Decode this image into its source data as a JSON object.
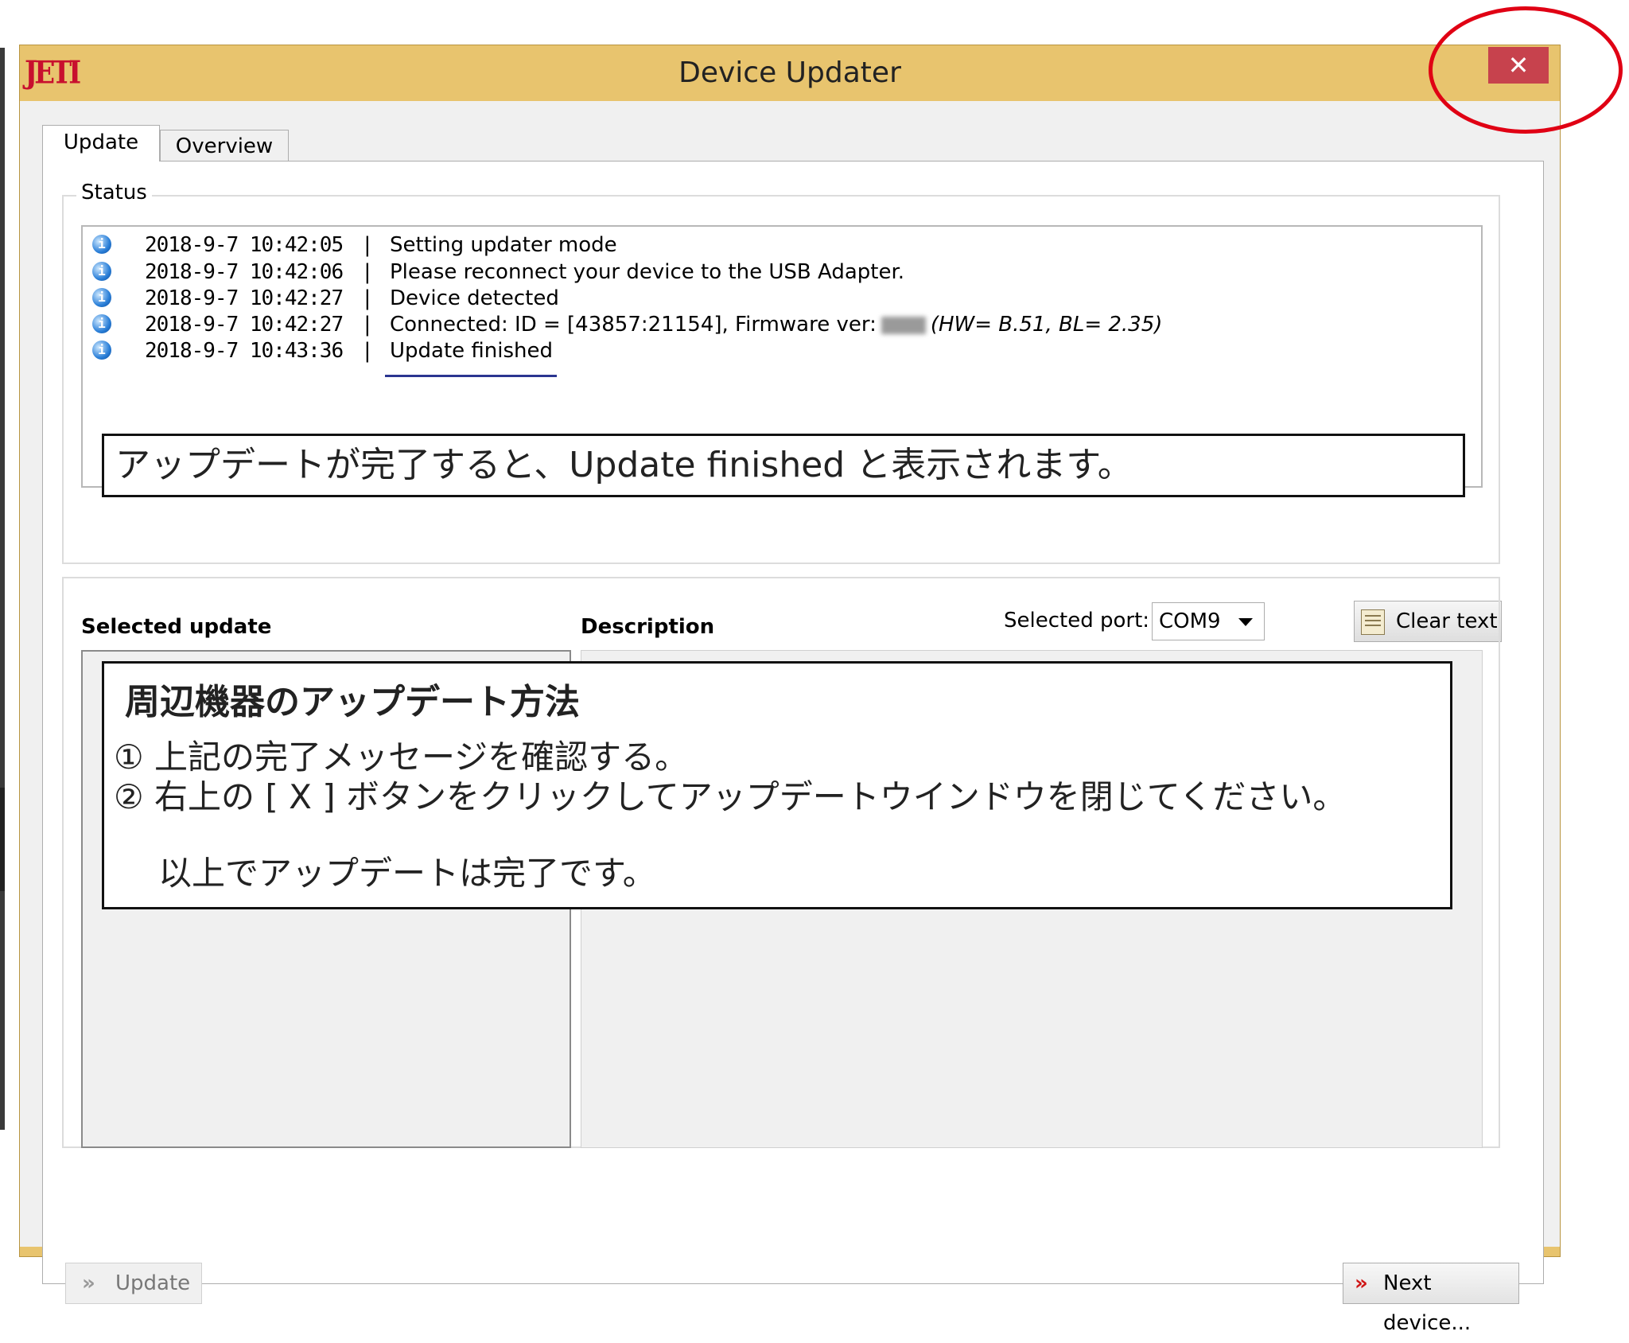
{
  "window": {
    "title": "Device Updater",
    "logo_text": "JETI",
    "close_label": "✕"
  },
  "tabs": [
    {
      "label": "Update",
      "active": true
    },
    {
      "label": "Overview",
      "active": false
    }
  ],
  "status": {
    "group_label": "Status",
    "log": [
      {
        "time": "2018-9-7 10:42:05",
        "sep": "|",
        "message": "Setting updater mode"
      },
      {
        "time": "2018-9-7 10:42:06",
        "sep": "|",
        "message": "Please reconnect your device to the USB Adapter."
      },
      {
        "time": "2018-9-7 10:42:27",
        "sep": "|",
        "message": "Device detected"
      },
      {
        "time": "2018-9-7 10:42:27",
        "sep": "|",
        "message_prefix": "Connected: ID = [43857:21154], Firmware ver:",
        "message_suffix": "(HW= B.51, BL= 2.35)"
      },
      {
        "time": "2018-9-7 10:43:36",
        "sep": "|",
        "message": "Update finished"
      }
    ],
    "annotation": "アップデートが完了すると、Update finished と表示されます。",
    "port_label": "Selected port:",
    "port_value": "COM9",
    "clear_label": "Clear text"
  },
  "update_section": {
    "selected_update_header": "Selected update",
    "description_header": "Description",
    "annotation": {
      "title": "周辺機器のアップデート方法",
      "line1": "① 上記の完了メッセージを確認する。",
      "line2": "② 右上の [ X ] ボタンをクリックしてアップデートウインドウを閉じてください。",
      "line3": "以上でアップデートは完了です。"
    },
    "update_button": "Update",
    "next_button": "Next device..."
  },
  "icons": {
    "log_info": "info-icon",
    "clear": "notepad-icon",
    "update_chevron": "double-chevron-right-icon",
    "next_chevron": "double-chevron-right-icon"
  },
  "colors": {
    "titlebar": "#e8c46e",
    "close_button": "#c7424d",
    "highlight_circle": "#e00014",
    "next_chevron": "#d01515"
  }
}
